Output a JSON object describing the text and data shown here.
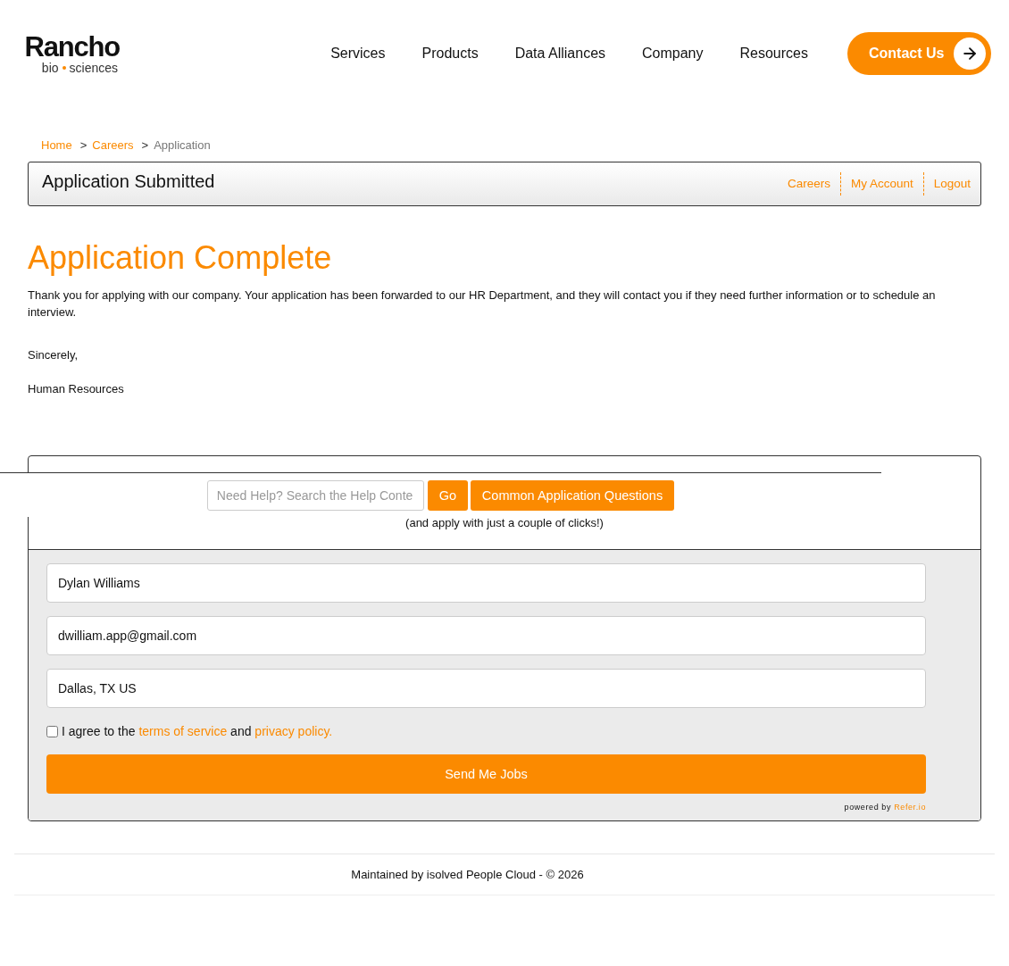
{
  "header": {
    "logo": {
      "name": "Rancho",
      "tagline": [
        "bio",
        "sciences"
      ]
    },
    "nav": [
      {
        "label": "Services"
      },
      {
        "label": "Products"
      },
      {
        "label": "Data Alliances"
      },
      {
        "label": "Company"
      },
      {
        "label": "Resources"
      }
    ],
    "contact_button": "Contact Us"
  },
  "breadcrumb": [
    {
      "label": "Home",
      "current": false
    },
    {
      "separator": ">",
      "label": "Careers",
      "current": false
    },
    {
      "separator": ">",
      "label": "Application",
      "current": true
    }
  ],
  "title_bar": {
    "title": "Application Submitted",
    "links": [
      "Careers",
      "My Account",
      "Logout"
    ]
  },
  "content": {
    "heading": "Application Complete",
    "message": "Thank you for applying with our company. Your application has been forwarded to our HR Department, and they will contact you if they need further information or to schedule an interview.",
    "closing": "Sincerely,",
    "signature": "Human Resources"
  },
  "job_alert": {
    "search": {
      "placeholder": "Need Help? Search the Help Conte"
    },
    "go_button": "Go",
    "faq_button": "Common Application Questions",
    "subtitle": "(and apply with just a couple of clicks!)",
    "fields": [
      {
        "value": "Dylan Williams"
      },
      {
        "value": "dwilliam.app@gmail.com"
      },
      {
        "value": "Dallas, TX US"
      }
    ],
    "agree": {
      "checked": false,
      "text": "I agree to the",
      "terms_link": "terms of service",
      "middle": "and",
      "privacy_link": "privacy policy."
    },
    "submit": "Send Me Jobs",
    "powered_by": "powered by",
    "powered_brand": "Refer.io"
  },
  "footer": {
    "text": "Maintained by isolved People Cloud - © 2026"
  }
}
